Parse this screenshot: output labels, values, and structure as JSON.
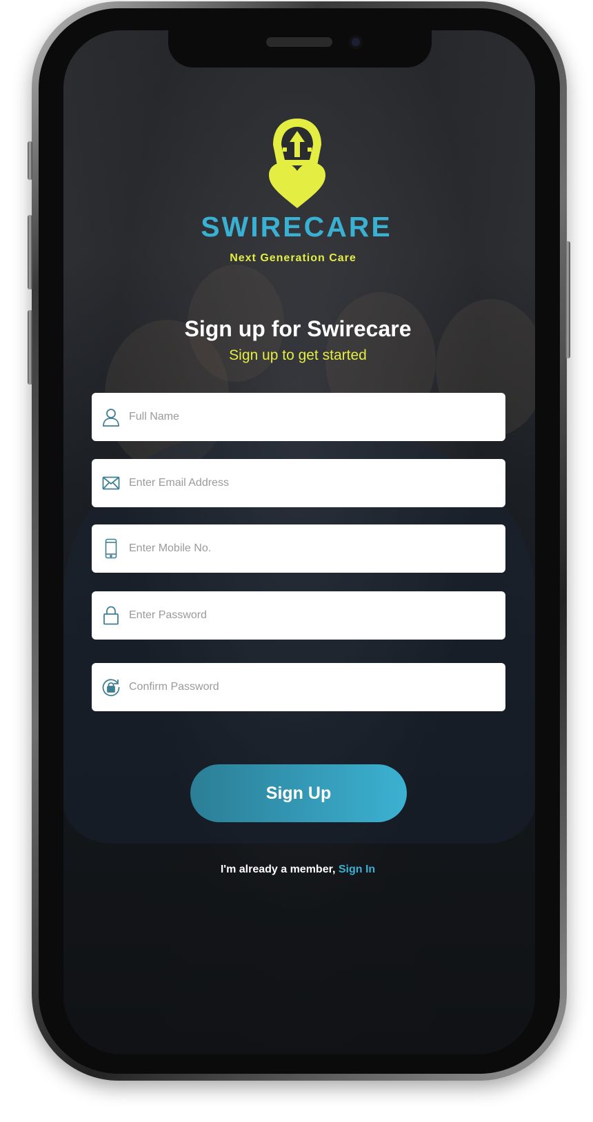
{
  "brand": {
    "name": "SWIRECARE",
    "tagline": "Next Generation Care",
    "logo_icon": "footprint-arrow-heart-icon",
    "colors": {
      "primary": "#3ab0d3",
      "accent": "#e4ee42"
    }
  },
  "header": {
    "title": "Sign up for Swirecare",
    "subtitle": "Sign up to get started"
  },
  "form": {
    "fields": [
      {
        "icon": "user-icon",
        "placeholder": "Full Name",
        "value": ""
      },
      {
        "icon": "envelope-icon",
        "placeholder": "Enter Email Address",
        "value": ""
      },
      {
        "icon": "mobile-phone-icon",
        "placeholder": "Enter Mobile No.",
        "value": ""
      },
      {
        "icon": "lock-icon",
        "placeholder": "Enter Password",
        "value": ""
      },
      {
        "icon": "lock-refresh-icon",
        "placeholder": "Confirm Password",
        "value": ""
      }
    ],
    "submit_label": "Sign Up"
  },
  "footer": {
    "member_text": "I'm already a member, ",
    "signin_label": "Sign In"
  }
}
